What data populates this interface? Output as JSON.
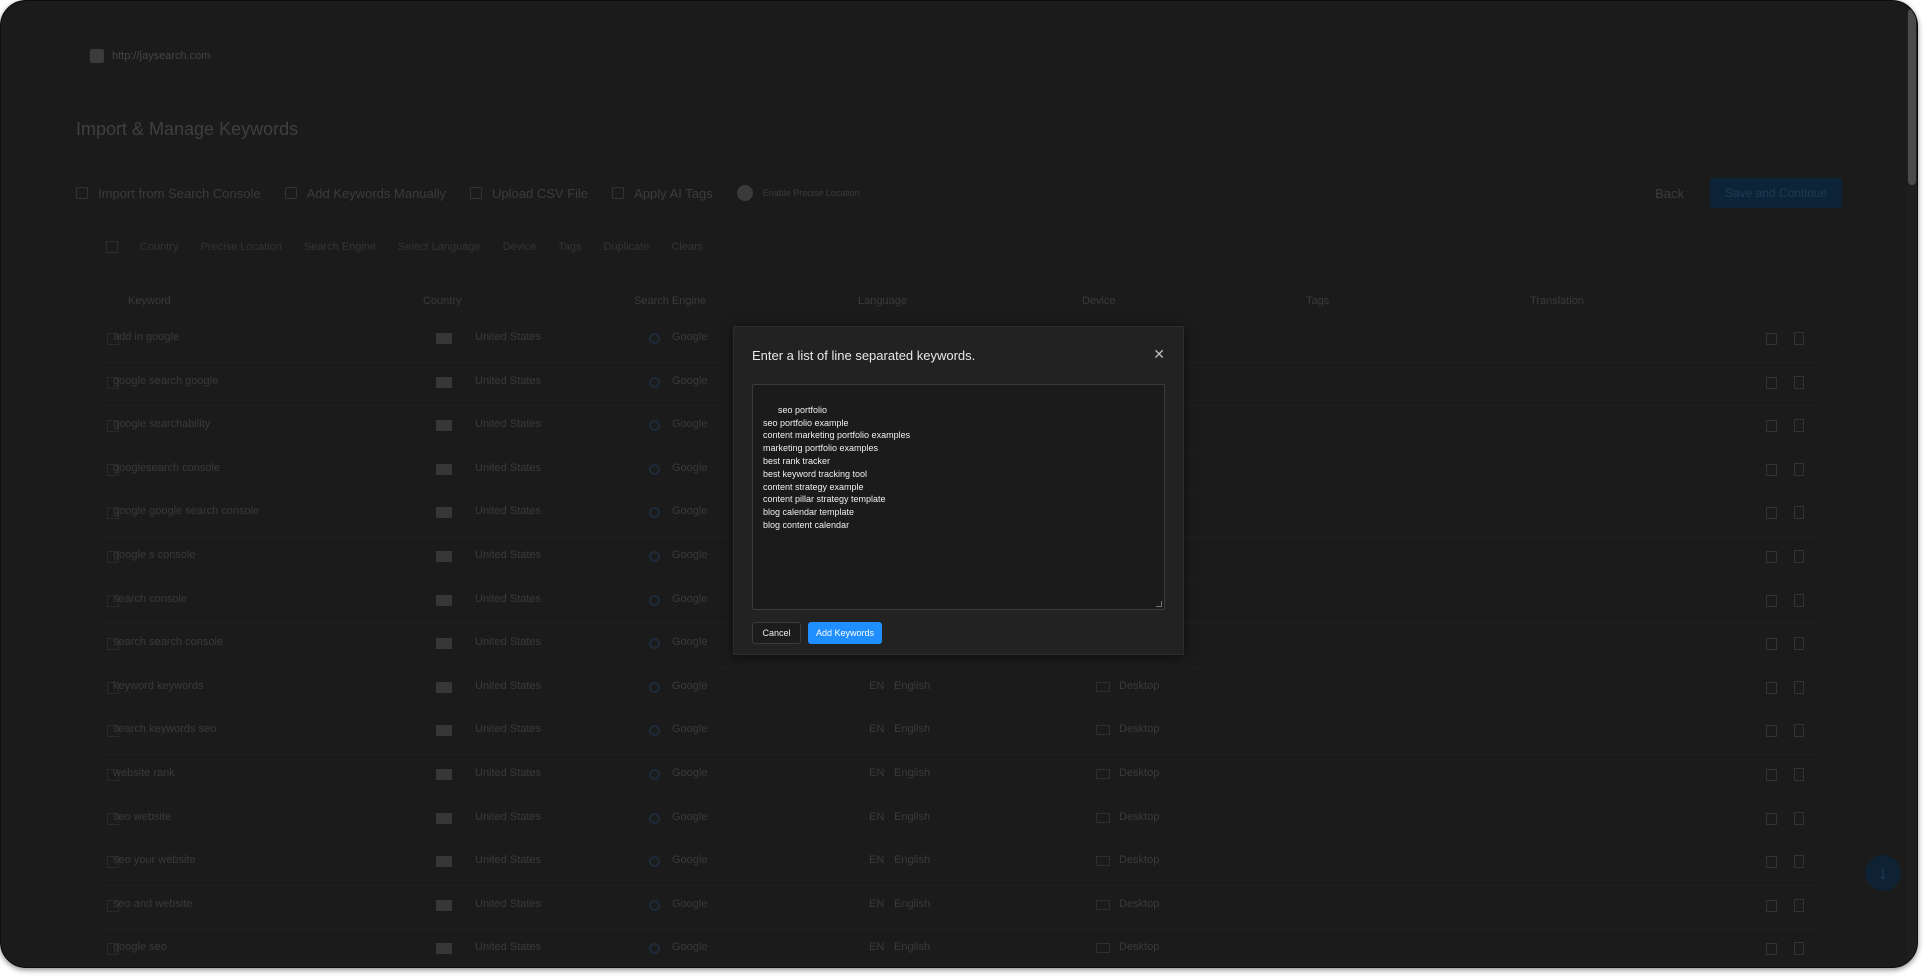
{
  "site": {
    "url": "http://jaysearch.com",
    "favicon": "favicon-icon"
  },
  "page": {
    "title": "Import & Manage Keywords"
  },
  "toolbar": {
    "import_label": "Import from Search Console",
    "add_manual_label": "Add Keywords Manually",
    "upload_label": "Upload CSV File",
    "ai_tags_label": "Apply AI Tags",
    "precise_label": "Enable Precise Location",
    "back_label": "Back",
    "save_label": "Save and Continue"
  },
  "filters": [
    "Country",
    "Precise Location",
    "Search Engine",
    "Select Language",
    "Device",
    "Tags",
    "Duplicate",
    "Clears"
  ],
  "table": {
    "headers": [
      "Keyword",
      "Country",
      "Search Engine",
      "Language",
      "Device",
      "Tags",
      "Translation"
    ],
    "rows": [
      {
        "keyword": "add in google",
        "country": "United States",
        "engine": "Google",
        "language": "",
        "lang_code": "",
        "device": ""
      },
      {
        "keyword": "google search google",
        "country": "United States",
        "engine": "Google",
        "language": "",
        "lang_code": "",
        "device": ""
      },
      {
        "keyword": "google searchability",
        "country": "United States",
        "engine": "Google",
        "language": "",
        "lang_code": "",
        "device": ""
      },
      {
        "keyword": "googlesearch console",
        "country": "United States",
        "engine": "Google",
        "language": "",
        "lang_code": "",
        "device": ""
      },
      {
        "keyword": "google google search console",
        "country": "United States",
        "engine": "Google",
        "language": "",
        "lang_code": "",
        "device": ""
      },
      {
        "keyword": "google s console",
        "country": "United States",
        "engine": "Google",
        "language": "",
        "lang_code": "",
        "device": ""
      },
      {
        "keyword": "search console",
        "country": "United States",
        "engine": "Google",
        "language": "",
        "lang_code": "",
        "device": ""
      },
      {
        "keyword": "search search console",
        "country": "United States",
        "engine": "Google",
        "language": "",
        "lang_code": "",
        "device": ""
      },
      {
        "keyword": "keyword keywords",
        "country": "United States",
        "engine": "Google",
        "language": "English",
        "lang_code": "EN",
        "device": "Desktop"
      },
      {
        "keyword": "search keywords seo",
        "country": "United States",
        "engine": "Google",
        "language": "English",
        "lang_code": "EN",
        "device": "Desktop"
      },
      {
        "keyword": "website rank",
        "country": "United States",
        "engine": "Google",
        "language": "English",
        "lang_code": "EN",
        "device": "Desktop"
      },
      {
        "keyword": "seo website",
        "country": "United States",
        "engine": "Google",
        "language": "English",
        "lang_code": "EN",
        "device": "Desktop"
      },
      {
        "keyword": "seo your website",
        "country": "United States",
        "engine": "Google",
        "language": "English",
        "lang_code": "EN",
        "device": "Desktop"
      },
      {
        "keyword": "seo and website",
        "country": "United States",
        "engine": "Google",
        "language": "English",
        "lang_code": "EN",
        "device": "Desktop"
      },
      {
        "keyword": "google seo",
        "country": "United States",
        "engine": "Google",
        "language": "English",
        "lang_code": "EN",
        "device": "Desktop"
      }
    ]
  },
  "modal": {
    "title": "Enter a list of line separated keywords.",
    "keywords": "seo portfolio\nseo portfolio example\ncontent marketing portfolio examples\nmarketing portfolio examples\nbest rank tracker\nbest keyword tracking tool\ncontent strategy example\ncontent pillar strategy template\nblog calendar template\nblog content calendar",
    "cancel_label": "Cancel",
    "add_label": "Add Keywords",
    "close_icon": "close-icon"
  },
  "colors": {
    "accent": "#1f8fff",
    "overlay_bg": "#1b1b1b",
    "modal_bg": "#222222"
  }
}
